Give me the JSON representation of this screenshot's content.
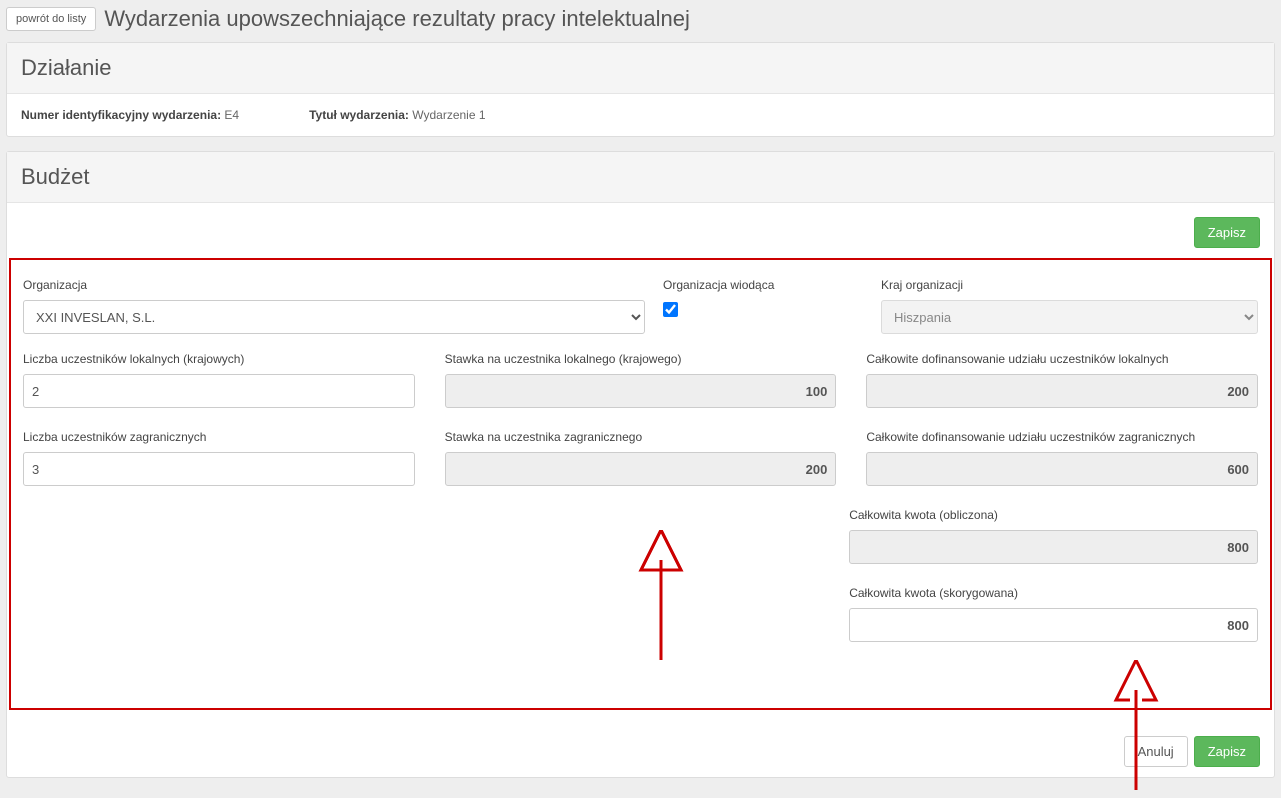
{
  "header": {
    "back_label": "powrót do listy",
    "title": "Wydarzenia upowszechniające rezultaty pracy intelektualnej"
  },
  "action_panel": {
    "heading": "Działanie",
    "event_id_label": "Numer identyfikacyjny wydarzenia:",
    "event_id_value": "E4",
    "event_title_label": "Tytuł wydarzenia:",
    "event_title_value": "Wydarzenie 1"
  },
  "budget_panel": {
    "heading": "Budżet",
    "save_label": "Zapisz"
  },
  "form": {
    "org_label": "Organizacja",
    "org_value": "XXI INVESLAN, S.L.",
    "lead_label": "Organizacja wiodąca",
    "lead_checked": true,
    "country_label": "Kraj organizacji",
    "country_value": "Hiszpania",
    "local_count_label": "Liczba uczestników lokalnych (krajowych)",
    "local_count_value": "2",
    "local_rate_label": "Stawka na uczestnika lokalnego (krajowego)",
    "local_rate_value": "100",
    "local_total_label": "Całkowite dofinansowanie udziału uczestników lokalnych",
    "local_total_value": "200",
    "foreign_count_label": "Liczba uczestników zagranicznych",
    "foreign_count_value": "3",
    "foreign_rate_label": "Stawka na uczestnika zagranicznego",
    "foreign_rate_value": "200",
    "foreign_total_label": "Całkowite dofinansowanie udziału uczestników zagranicznych",
    "foreign_total_value": "600",
    "total_calc_label": "Całkowita kwota (obliczona)",
    "total_calc_value": "800",
    "total_adj_label": "Całkowita kwota (skorygowana)",
    "total_adj_value": "800"
  },
  "footer": {
    "cancel": "Anuluj",
    "save": "Zapisz"
  }
}
